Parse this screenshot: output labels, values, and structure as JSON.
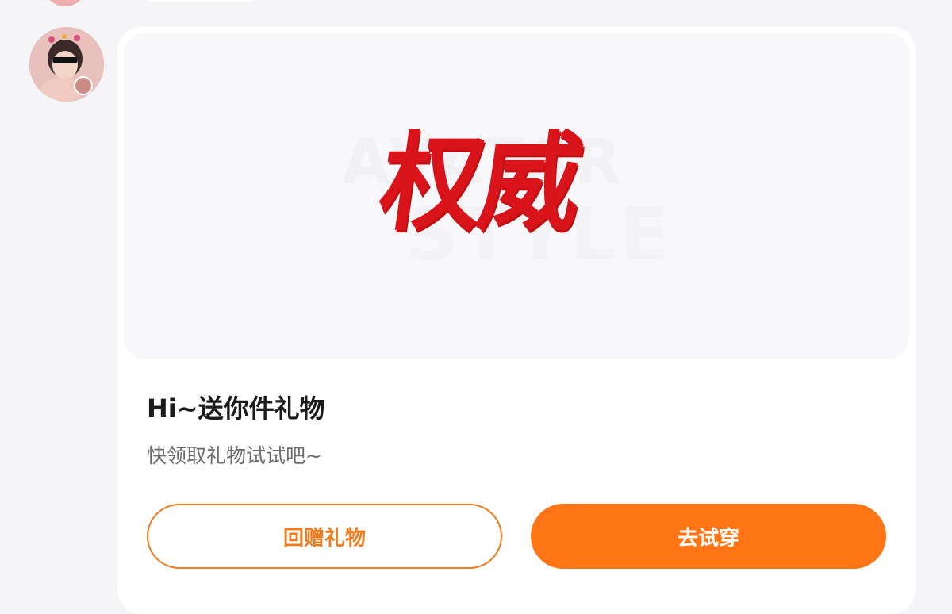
{
  "message": {
    "banner": {
      "calligraphy_text": "权威",
      "watermark_top": "AVATAR",
      "watermark_bottom": "STYLE"
    },
    "title": "Hi~送你件礼物",
    "subtitle": "快领取礼物试试吧~",
    "buttons": {
      "return_gift_label": "回赠礼物",
      "try_on_label": "去试穿"
    }
  },
  "colors": {
    "accent": "#ff7414",
    "outline": "#f07a1e",
    "calligraphy": "#d9151b",
    "background": "#f5f5f7"
  }
}
